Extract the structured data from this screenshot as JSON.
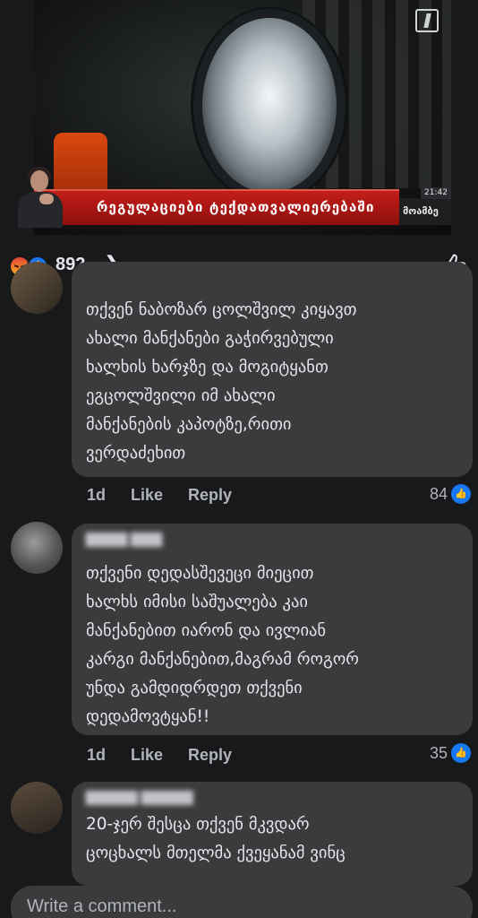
{
  "video": {
    "ticker_headline": "რეგულაციები ტექდათვალიერებაში",
    "channel_badge": "მოამბე",
    "time": "21:42"
  },
  "reactions": {
    "count": "892",
    "chevron": "❯"
  },
  "comments": [
    {
      "text": "თქვენ ნაბოზარ ცოლშვილ კიყავთ\nახალი მანქანები გაჭირვებული\nხალხის ხარჯზე და მოგიტყანთ\nეგცოლშვილი იმ ახალი\nმანქანების კაპოტზე,რითი\nვერდაძეხით",
      "age": "1d",
      "like_label": "Like",
      "reply_label": "Reply",
      "likes": "84"
    },
    {
      "text": "თქვენი დედასშევეცი მიეცით\nხალხს იმისი საშუალება კაი\nმანქანებით იარონ და ივლიან\nკარგი მანქანებით,მაგრამ როგორ\nუნდა გამდიდრდეთ თქვენი\nდედამოვტყან!!",
      "age": "1d",
      "like_label": "Like",
      "reply_label": "Reply",
      "likes": "35"
    },
    {
      "text": "20-ჯერ შესცა თქვენ მკვდარ\nცოცხალს მთელმა ქვეყანამ ვინც",
      "age": "",
      "like_label": "",
      "reply_label": "",
      "likes": ""
    }
  ],
  "compose": {
    "placeholder": "Write a comment..."
  },
  "icons": {
    "reaction_1": "angry-icon",
    "reaction_2": "like-icon",
    "page_like": "thumbs-up-outline-icon"
  },
  "colors": {
    "background": "#18191a",
    "bubble": "#3a3b3c",
    "accent": "#1877f2",
    "ticker_red": "#c41e1a"
  }
}
